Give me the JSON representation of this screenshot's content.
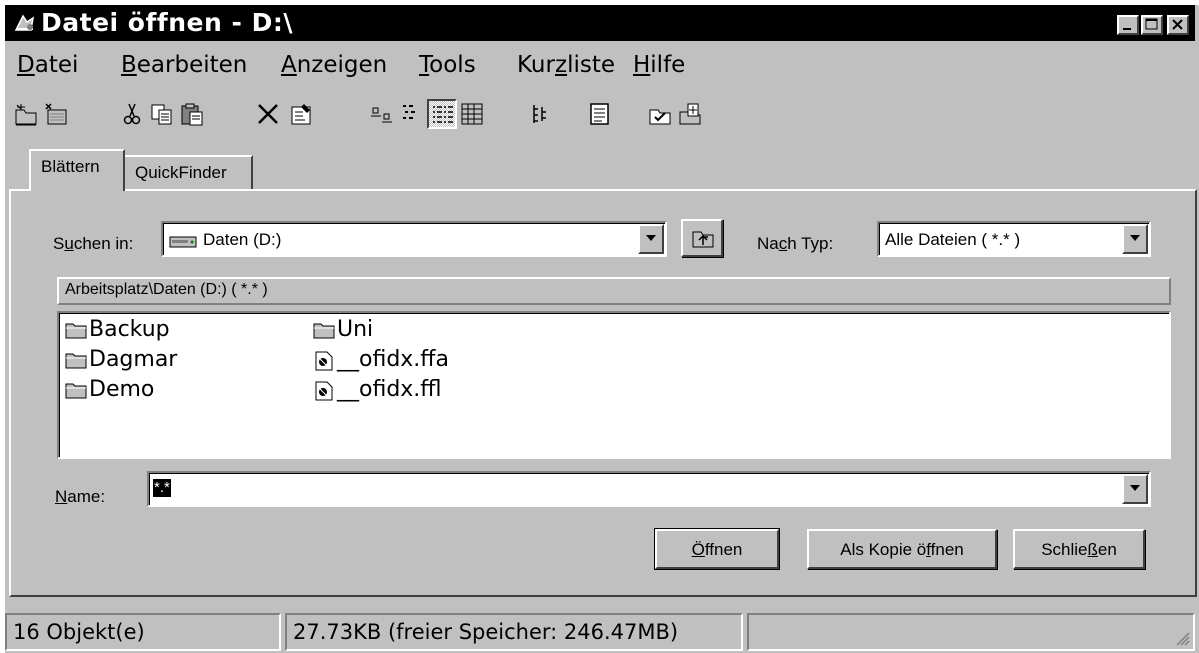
{
  "window": {
    "title": "Datei öffnen - D:\\",
    "icon": "open-file-icon",
    "controls": [
      "minimize-icon",
      "maximize-icon",
      "close-icon"
    ]
  },
  "menu": [
    {
      "pre": "",
      "u": "D",
      "post": "atei"
    },
    {
      "pre": "",
      "u": "B",
      "post": "earbeiten"
    },
    {
      "pre": "",
      "u": "A",
      "post": "nzeigen"
    },
    {
      "pre": "",
      "u": "T",
      "post": "ools"
    },
    {
      "pre": "Kur",
      "u": "z",
      "post": "liste"
    },
    {
      "pre": "",
      "u": "H",
      "post": "ilfe"
    }
  ],
  "toolbar": {
    "icons": [
      "new-folder-icon",
      "map-drive-icon",
      "cut-icon",
      "copy-icon",
      "paste-icon",
      "delete-icon",
      "properties-icon",
      "large-icons-icon",
      "small-icons-icon",
      "list-view-icon",
      "details-view-icon",
      "tree-view-icon",
      "preview-icon",
      "select-icon",
      "bookmark-icon"
    ],
    "pressed": "list-view-icon"
  },
  "tabs": [
    {
      "label": "Blättern",
      "active": true
    },
    {
      "label": "QuickFinder",
      "active": false
    }
  ],
  "search_in": {
    "label_pre": "S",
    "label_u": "u",
    "label_post": "chen in:",
    "value": "Daten (D:)",
    "icon": "drive-icon"
  },
  "file_type": {
    "label_pre": "Na",
    "label_u": "c",
    "label_post": "h Typ:",
    "value": "Alle Dateien ( *.* )"
  },
  "path_header": "Arbeitsplatz\\Daten (D:)   ( *.* )",
  "files": [
    {
      "name": "Backup",
      "icon": "folder-icon"
    },
    {
      "name": "Dagmar",
      "icon": "folder-icon"
    },
    {
      "name": "Demo",
      "icon": "folder-icon"
    },
    {
      "name": "Uni",
      "icon": "folder-icon"
    },
    {
      "name": "__ofidx.ffa",
      "icon": "file-icon"
    },
    {
      "name": "__ofidx.ffl",
      "icon": "file-icon"
    }
  ],
  "name_field": {
    "label_u": "N",
    "label_post": "ame:",
    "value": "*.*"
  },
  "buttons": {
    "open": {
      "u": "Ö",
      "post": "ffnen"
    },
    "open_copy": {
      "pre": "Als Kopie ö",
      "u": "f",
      "post": "fnen"
    },
    "close": {
      "pre": "Schlie",
      "u": "ß",
      "post": "en"
    }
  },
  "status": {
    "objects": "16 Objekt(e)",
    "size": "27.73KB (freier Speicher: 246.47MB)"
  }
}
